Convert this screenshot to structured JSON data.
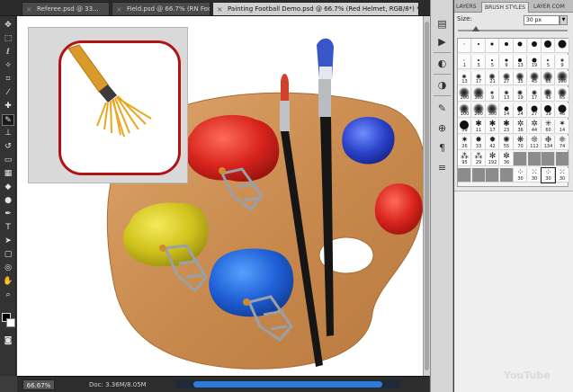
{
  "tabs": [
    {
      "label": "Referee.psd @ 33..."
    },
    {
      "label": "Field.psd @ 66.7% (RN Foo..."
    },
    {
      "label": "Painting Football Demo.psd @ 66.7% (Red Helmet, RGB/8*) *"
    }
  ],
  "tab_close_glyph": "×",
  "status": {
    "zoom": "66.67%",
    "doc": "Doc: 3.36M/8.05M"
  },
  "panel": {
    "tabs": [
      "LAYERS",
      "BRUSH STYLES",
      "LAYER COM"
    ],
    "size_label": "Size:",
    "size_value": "30 px"
  },
  "brush_cells": [
    {
      "label": "",
      "kind": "dot",
      "d": 1
    },
    {
      "label": "",
      "kind": "dot",
      "d": 2
    },
    {
      "label": "",
      "kind": "dot",
      "d": 3
    },
    {
      "label": "",
      "kind": "dot",
      "d": 4
    },
    {
      "label": "",
      "kind": "dot",
      "d": 5
    },
    {
      "label": "",
      "kind": "dot",
      "d": 6
    },
    {
      "label": "",
      "kind": "dot",
      "d": 8
    },
    {
      "label": "",
      "kind": "dot",
      "d": 9
    },
    {
      "label": "1",
      "kind": "dot",
      "d": 1
    },
    {
      "label": "3",
      "kind": "dot",
      "d": 2
    },
    {
      "label": "5",
      "kind": "dot",
      "d": 2
    },
    {
      "label": "9",
      "kind": "dot",
      "d": 3
    },
    {
      "label": "13",
      "kind": "dot",
      "d": 4
    },
    {
      "label": "19",
      "kind": "dot",
      "d": 5
    },
    {
      "label": "5",
      "kind": "soft",
      "d": 3
    },
    {
      "label": "9",
      "kind": "soft",
      "d": 4
    },
    {
      "label": "13",
      "kind": "soft",
      "d": 5
    },
    {
      "label": "17",
      "kind": "soft",
      "d": 6
    },
    {
      "label": "21",
      "kind": "soft",
      "d": 7
    },
    {
      "label": "27",
      "kind": "soft",
      "d": 8
    },
    {
      "label": "35",
      "kind": "soft",
      "d": 9
    },
    {
      "label": "45",
      "kind": "soft",
      "d": 10
    },
    {
      "label": "65",
      "kind": "soft",
      "d": 11
    },
    {
      "label": "100",
      "kind": "soft",
      "d": 12
    },
    {
      "label": "200",
      "kind": "soft",
      "d": 12
    },
    {
      "label": "300",
      "kind": "soft",
      "d": 12
    },
    {
      "label": "9",
      "kind": "soft",
      "d": 4
    },
    {
      "label": "13",
      "kind": "soft",
      "d": 5
    },
    {
      "label": "19",
      "kind": "soft",
      "d": 6
    },
    {
      "label": "17",
      "kind": "soft",
      "d": 6
    },
    {
      "label": "45",
      "kind": "soft",
      "d": 9
    },
    {
      "label": "65",
      "kind": "soft",
      "d": 10
    },
    {
      "label": "100",
      "kind": "soft",
      "d": 11
    },
    {
      "label": "200",
      "kind": "soft",
      "d": 12
    },
    {
      "label": "300",
      "kind": "soft",
      "d": 12
    },
    {
      "label": "14",
      "kind": "dot",
      "d": 5
    },
    {
      "label": "24",
      "kind": "dot",
      "d": 6
    },
    {
      "label": "27",
      "kind": "dot",
      "d": 7
    },
    {
      "label": "39",
      "kind": "dot",
      "d": 8
    },
    {
      "label": "46",
      "kind": "dot",
      "d": 9
    },
    {
      "label": "59",
      "kind": "dot",
      "d": 10
    },
    {
      "label": "11",
      "kind": "shape",
      "g": "✱"
    },
    {
      "label": "17",
      "kind": "shape",
      "g": "✱"
    },
    {
      "label": "23",
      "kind": "shape",
      "g": "✱"
    },
    {
      "label": "36",
      "kind": "shape",
      "g": "✲"
    },
    {
      "label": "44",
      "kind": "shape",
      "g": "✲"
    },
    {
      "label": "60",
      "kind": "shape",
      "g": "✳"
    },
    {
      "label": "14",
      "kind": "shape",
      "g": "✶"
    },
    {
      "label": "26",
      "kind": "shape",
      "g": "✷"
    },
    {
      "label": "33",
      "kind": "shape",
      "g": "✸"
    },
    {
      "label": "42",
      "kind": "shape",
      "g": "✹"
    },
    {
      "label": "55",
      "kind": "shape",
      "g": "✺"
    },
    {
      "label": "70",
      "kind": "shape",
      "g": "❋"
    },
    {
      "label": "112",
      "kind": "shape",
      "g": "❊"
    },
    {
      "label": "134",
      "kind": "shape",
      "g": "❉"
    },
    {
      "label": "74",
      "kind": "shape",
      "g": "❈"
    },
    {
      "label": "95",
      "kind": "shape",
      "g": "⁂"
    },
    {
      "label": "29",
      "kind": "shape",
      "g": "⁂"
    },
    {
      "label": "192",
      "kind": "shape",
      "g": "✻"
    },
    {
      "label": "36",
      "kind": "shape",
      "g": "✼"
    },
    {
      "label": "",
      "kind": "dark"
    },
    {
      "label": "",
      "kind": "dark"
    },
    {
      "label": "",
      "kind": "dark"
    },
    {
      "label": "",
      "kind": "dark"
    },
    {
      "label": "",
      "kind": "dark"
    },
    {
      "label": "",
      "kind": "dark"
    },
    {
      "label": "",
      "kind": "dark"
    },
    {
      "label": "",
      "kind": "dark"
    },
    {
      "label": "30",
      "kind": "shape",
      "g": "⁘"
    },
    {
      "label": "30",
      "kind": "shape",
      "g": "⁙"
    },
    {
      "label": "30",
      "kind": "shape",
      "g": "⁘",
      "sel": true
    },
    {
      "label": "30",
      "kind": "shape",
      "g": "⁙"
    }
  ],
  "watermark": "YouTube"
}
